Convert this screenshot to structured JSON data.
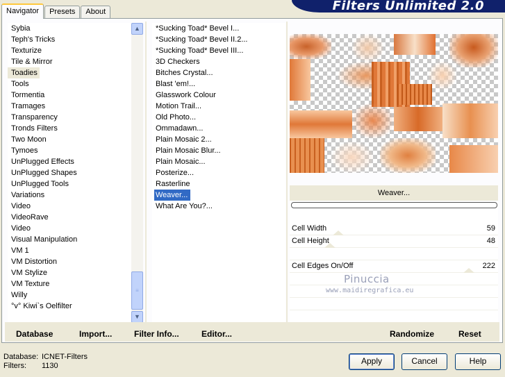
{
  "tabs": [
    "Navigator",
    "Presets",
    "About"
  ],
  "banner_title": "Filters Unlimited 2.0",
  "categories": [
    "Sybia",
    "Teph's Tricks",
    "Texturize",
    "Tile & Mirror",
    "Toadies",
    "Tools",
    "Tormentia",
    "Tramages",
    "Transparency",
    "Tronds Filters",
    "Two Moon",
    "Tymoes",
    "UnPlugged Effects",
    "UnPlugged Shapes",
    "UnPlugged Tools",
    "Variations",
    "Video",
    "VideoRave",
    "Video",
    "Visual Manipulation",
    "VM 1",
    "VM Distortion",
    "VM Stylize",
    "VM Texture",
    "Willy",
    "°v° Kiwi`s Oelfilter"
  ],
  "selected_category": "Toadies",
  "filters": [
    "*Sucking Toad*  Bevel I...",
    "*Sucking Toad*  Bevel II.2...",
    "*Sucking Toad*  Bevel III...",
    "3D Checkers",
    "Bitches Crystal...",
    "Blast 'em!...",
    "Glasswork Colour",
    "Motion Trail...",
    "Old Photo...",
    "Ommadawn...",
    "Plain Mosaic 2...",
    "Plain Mosaic Blur...",
    "Plain Mosaic...",
    "Posterize...",
    "Rasterline",
    "Weaver...",
    "What Are You?..."
  ],
  "selected_filter": "Weaver...",
  "filter_name": "Weaver...",
  "progress": 0,
  "params": [
    {
      "label": "Cell Width",
      "value": "59",
      "level": 59
    },
    {
      "label": "Cell Height",
      "value": "48",
      "level": 48
    },
    {
      "label": "Cell Edges On/Off",
      "value": "222",
      "level": 222
    }
  ],
  "watermark": {
    "name": "Pinuccia",
    "url": "www.maidiregrafica.eu"
  },
  "panel_links": {
    "database": "Database",
    "import": "Import...",
    "filter_info": "Filter Info...",
    "editor": "Editor...",
    "randomize": "Randomize",
    "reset": "Reset"
  },
  "status": {
    "database_label": "Database:",
    "database_value": "ICNET-Filters",
    "filters_label": "Filters:",
    "filters_value": "1130"
  },
  "buttons": {
    "apply": "Apply",
    "cancel": "Cancel",
    "help": "Help"
  },
  "colors": {
    "accent_selection": "#316ac5",
    "banner": "#10216b",
    "dialog_bg": "#ece9d8"
  },
  "icons": {
    "scroll_up": "chevron-up-icon",
    "scroll_down": "chevron-down-icon",
    "scroll_grip": "grip-icon"
  }
}
